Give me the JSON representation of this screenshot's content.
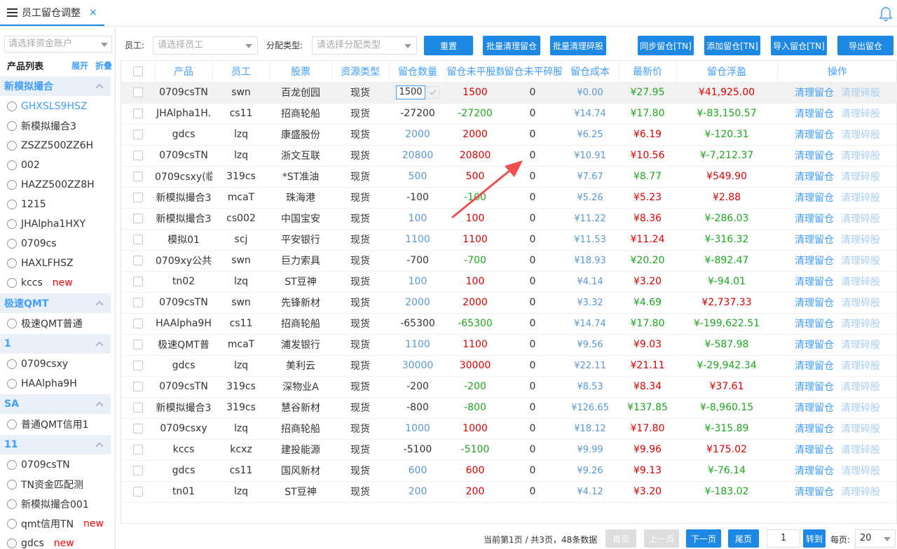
{
  "tab": {
    "title": "员工留仓调整",
    "close": "×"
  },
  "sidebar": {
    "account_placeholder": "请选择资金账户",
    "list_title": "产品列表",
    "expand": "展开",
    "collapse": "折叠",
    "groups": [
      {
        "name": "新模拟撮合",
        "items": [
          {
            "label": "GHXSLS9HSZ",
            "active": true
          },
          {
            "label": "新模拟撮合3"
          },
          {
            "label": "ZSZZ500ZZ6H"
          },
          {
            "label": "002"
          },
          {
            "label": "HAZZ500ZZ8H"
          },
          {
            "label": "1215"
          },
          {
            "label": "JHAlpha1HXY"
          },
          {
            "label": "0709cs"
          },
          {
            "label": "HAXLFHSZ"
          },
          {
            "label": "kccs",
            "tag": "new"
          }
        ]
      },
      {
        "name": "极速QMT",
        "items": [
          {
            "label": "极速QMT普通"
          }
        ]
      },
      {
        "name": "1",
        "items": [
          {
            "label": "0709csxy"
          },
          {
            "label": "HAAlpha9H"
          }
        ]
      },
      {
        "name": "SA",
        "items": [
          {
            "label": "普通QMT信用1"
          }
        ]
      },
      {
        "name": "11",
        "items": [
          {
            "label": "0709csTN"
          },
          {
            "label": "TN资金匹配测"
          },
          {
            "label": "新模拟撮合001"
          },
          {
            "label": "qmt信用TN",
            "tag": "new"
          },
          {
            "label": "gdcs",
            "tag": "new"
          }
        ]
      }
    ]
  },
  "toolbar": {
    "employee_label": "员工:",
    "employee_placeholder": "请选择员工",
    "alloc_label": "分配类型:",
    "alloc_placeholder": "请选择分配类型",
    "buttons": [
      "重置",
      "批量清理留仓",
      "批量清理碎股",
      "同步留仓[TN]",
      "添加留仓[TN]",
      "导入留仓[TN]",
      "导出留仓"
    ]
  },
  "table": {
    "headers": [
      "产品",
      "员工",
      "股票",
      "资源类型",
      "留仓数量",
      "留仓未平股数",
      "留仓未平碎股",
      "留仓成本",
      "最新价",
      "留仓浮盈",
      "操作"
    ],
    "op_clear": "清理留仓",
    "op_odd": "清理碎股",
    "rows": [
      {
        "product": "0709csTN",
        "employee": "swn",
        "stock": "百龙创园",
        "type": "现货",
        "qty": "1500",
        "open": "1500",
        "odd": "0",
        "cost": "¥0.00",
        "price": "¥27.95",
        "pnl": "¥41,925.00",
        "editing": true
      },
      {
        "product": "JHAlpha1H.",
        "employee": "cs11",
        "stock": "招商轮船",
        "type": "现货",
        "qty": "-27200",
        "open": "-27200",
        "odd": "0",
        "cost": "¥14.74",
        "price": "¥17.80",
        "pnl": "¥-83,150.57"
      },
      {
        "product": "gdcs",
        "employee": "lzq",
        "stock": "康盛股份",
        "type": "现货",
        "qty": "2000",
        "open": "2000",
        "odd": "0",
        "cost": "¥6.25",
        "price": "¥6.19",
        "pnl": "¥-120.31"
      },
      {
        "product": "0709csTN",
        "employee": "lzq",
        "stock": "浙文互联",
        "type": "现货",
        "qty": "20800",
        "open": "20800",
        "odd": "0",
        "cost": "¥10.91",
        "price": "¥10.56",
        "pnl": "¥-7,212.37"
      },
      {
        "product": "0709csxy(临",
        "employee": "319cs",
        "stock": "*ST准油",
        "type": "现货",
        "qty": "500",
        "open": "500",
        "odd": "0",
        "cost": "¥7.67",
        "price": "¥8.77",
        "pnl": "¥549.90"
      },
      {
        "product": "新模拟撮合3",
        "employee": "mcaT",
        "stock": "珠海港",
        "type": "现货",
        "qty": "-100",
        "open": "-100",
        "odd": "0",
        "cost": "¥5.26",
        "price": "¥5.23",
        "pnl": "¥2.88"
      },
      {
        "product": "新模拟撮合3",
        "employee": "cs002",
        "stock": "中国宝安",
        "type": "现货",
        "qty": "100",
        "open": "100",
        "odd": "0",
        "cost": "¥11.22",
        "price": "¥8.36",
        "pnl": "¥-286.03"
      },
      {
        "product": "模拟01",
        "employee": "scj",
        "stock": "平安银行",
        "type": "现货",
        "qty": "1100",
        "open": "1100",
        "odd": "0",
        "cost": "¥11.53",
        "price": "¥11.24",
        "pnl": "¥-316.32"
      },
      {
        "product": "0709xy公共",
        "employee": "swn",
        "stock": "巨力索具",
        "type": "现货",
        "qty": "-700",
        "open": "-700",
        "odd": "0",
        "cost": "¥18.93",
        "price": "¥20.20",
        "pnl": "¥-892.47"
      },
      {
        "product": "tn02",
        "employee": "lzq",
        "stock": "ST豆神",
        "type": "现货",
        "qty": "100",
        "open": "100",
        "odd": "0",
        "cost": "¥4.14",
        "price": "¥3.20",
        "pnl": "¥-94.01"
      },
      {
        "product": "0709csTN",
        "employee": "swn",
        "stock": "先锋新材",
        "type": "现货",
        "qty": "2000",
        "open": "2000",
        "odd": "0",
        "cost": "¥3.32",
        "price": "¥4.69",
        "pnl": "¥2,737.33"
      },
      {
        "product": "HAAlpha9H",
        "employee": "cs11",
        "stock": "招商轮船",
        "type": "现货",
        "qty": "-65300",
        "open": "-65300",
        "odd": "0",
        "cost": "¥14.74",
        "price": "¥17.80",
        "pnl": "¥-199,622.51"
      },
      {
        "product": "极速QMT普",
        "employee": "mcaT",
        "stock": "浦发银行",
        "type": "现货",
        "qty": "1100",
        "open": "1100",
        "odd": "0",
        "cost": "¥9.56",
        "price": "¥9.03",
        "pnl": "¥-587.98"
      },
      {
        "product": "gdcs",
        "employee": "lzq",
        "stock": "美利云",
        "type": "现货",
        "qty": "30000",
        "open": "30000",
        "odd": "0",
        "cost": "¥22.11",
        "price": "¥21.11",
        "pnl": "¥-29,942.34"
      },
      {
        "product": "0709csTN",
        "employee": "319cs",
        "stock": "深物业A",
        "type": "现货",
        "qty": "-200",
        "open": "-200",
        "odd": "0",
        "cost": "¥8.53",
        "price": "¥8.34",
        "pnl": "¥37.61"
      },
      {
        "product": "新模拟撮合3",
        "employee": "319cs",
        "stock": "慧谷新材",
        "type": "现货",
        "qty": "-800",
        "open": "-800",
        "odd": "0",
        "cost": "¥126.65",
        "price": "¥137.85",
        "pnl": "¥-8,960.15"
      },
      {
        "product": "0709csxy",
        "employee": "lzq",
        "stock": "招商轮船",
        "type": "现货",
        "qty": "1000",
        "open": "1000",
        "odd": "0",
        "cost": "¥18.12",
        "price": "¥17.80",
        "pnl": "¥-315.89"
      },
      {
        "product": "kccs",
        "employee": "kcxz",
        "stock": "建投能源",
        "type": "现货",
        "qty": "-5100",
        "open": "-5100",
        "odd": "0",
        "cost": "¥9.99",
        "price": "¥9.96",
        "pnl": "¥175.02"
      },
      {
        "product": "gdcs",
        "employee": "cs11",
        "stock": "国风新材",
        "type": "现货",
        "qty": "600",
        "open": "600",
        "odd": "0",
        "cost": "¥9.26",
        "price": "¥9.13",
        "pnl": "¥-76.14"
      },
      {
        "product": "tn01",
        "employee": "lzq",
        "stock": "ST豆神",
        "type": "现货",
        "qty": "200",
        "open": "200",
        "odd": "0",
        "cost": "¥4.12",
        "price": "¥3.20",
        "pnl": "¥-183.02"
      }
    ]
  },
  "pager": {
    "info": "当前第1页 / 共3页，48条数据",
    "first": "首页",
    "prev": "上一页",
    "next": "下一页",
    "last": "尾页",
    "page_value": "1",
    "go": "转到",
    "per_page_label": "每页:",
    "per_page_value": "20"
  },
  "colors": {
    "accent": "#1e88e5",
    "header_text": "#409eff",
    "positive": "#e00000",
    "negative": "#1ca81c",
    "link_light": "#a9cdf0"
  }
}
